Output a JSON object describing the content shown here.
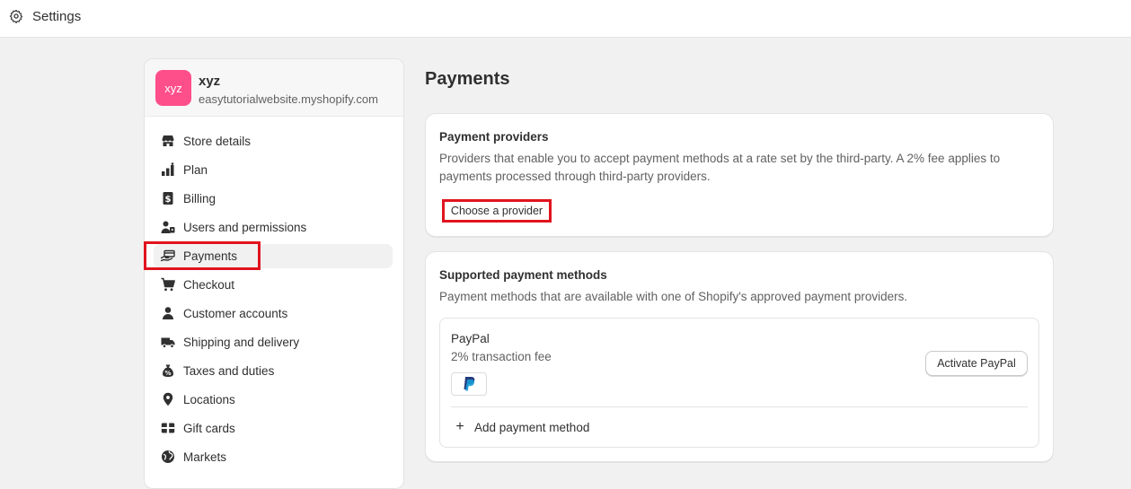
{
  "topbar": {
    "title": "Settings",
    "icon": "gear-icon"
  },
  "store": {
    "avatar_text": "xyz",
    "avatar_color": "#ff4f8b",
    "name": "xyz",
    "domain": "easytutorialwebsite.myshopify.com"
  },
  "sidebar": {
    "items": [
      {
        "label": "Store details",
        "icon": "store-icon"
      },
      {
        "label": "Plan",
        "icon": "plan-chart-icon"
      },
      {
        "label": "Billing",
        "icon": "billing-receipt-icon"
      },
      {
        "label": "Users and permissions",
        "icon": "users-icon"
      },
      {
        "label": "Payments",
        "icon": "payments-hand-icon",
        "active": true
      },
      {
        "label": "Checkout",
        "icon": "cart-icon"
      },
      {
        "label": "Customer accounts",
        "icon": "person-icon"
      },
      {
        "label": "Shipping and delivery",
        "icon": "truck-icon"
      },
      {
        "label": "Taxes and duties",
        "icon": "tax-bag-icon"
      },
      {
        "label": "Locations",
        "icon": "location-pin-icon"
      },
      {
        "label": "Gift cards",
        "icon": "gift-card-icon"
      },
      {
        "label": "Markets",
        "icon": "globe-icon"
      }
    ]
  },
  "main": {
    "title": "Payments",
    "providers": {
      "heading": "Payment providers",
      "description": "Providers that enable you to accept payment methods at a rate set by the third-party. A 2% fee applies to payments processed through third-party providers.",
      "button_label": "Choose a provider"
    },
    "supported": {
      "heading": "Supported payment methods",
      "description": "Payment methods that are available with one of Shopify's approved payment providers.",
      "method": {
        "name": "PayPal",
        "fee": "2% transaction fee",
        "logo": "paypal-logo-icon",
        "activate_label": "Activate PayPal"
      },
      "add_label": "Add payment method"
    }
  },
  "colors": {
    "highlight": "#e0141e",
    "background": "#f1f1f1",
    "card": "#ffffff",
    "text": "#303030",
    "subdued": "#616161"
  }
}
